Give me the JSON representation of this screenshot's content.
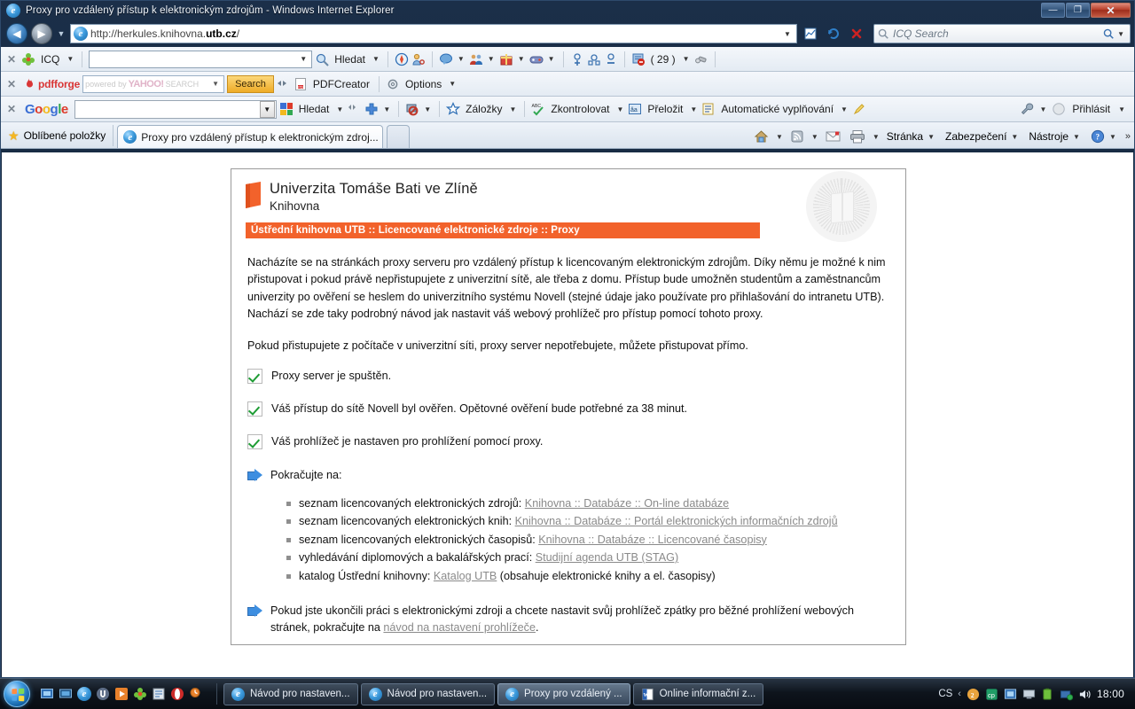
{
  "window": {
    "title": "Proxy pro vzdálený přístup k elektronickým zdrojům - Windows Internet Explorer",
    "minimize_label": "—",
    "maximize_label": "❐",
    "close_label": "✕"
  },
  "address_bar": {
    "url_prefix": "http://herkules.knihovna.",
    "url_bold": "utb.cz",
    "url_suffix": "/",
    "back_label": "◀",
    "forward_label": "▶",
    "history_caret": "▼",
    "page_caret": "▼",
    "refresh_label": "↻",
    "stop_label": "✕",
    "search_placeholder": "ICQ Search",
    "search_caret": "▼"
  },
  "icq_toolbar": {
    "close_label": "✕",
    "brand": "ICQ",
    "brand_caret": "▼",
    "input_value": "",
    "input_caret": "▼",
    "search_label": "Hledat",
    "search_caret": "▼",
    "messages_count": "( 29 )",
    "messages_caret": "▼",
    "caret": "▼",
    "icons": [
      "icq-flower-icon",
      "compass-icon",
      "person-key-icon",
      "chat-bubble-icon",
      "people-icon",
      "gift-icon",
      "game-controller-icon",
      "add-contact-icon",
      "find-contact-icon",
      "remove-contact-icon",
      "blocked-messages-icon",
      "flashlight-icon"
    ]
  },
  "pdfforge_toolbar": {
    "close_label": "✕",
    "brand": "pdfforge",
    "yahoo_powered": "powered by",
    "yahoo_logo": "YAHOO!",
    "yahoo_search_word": "SEARCH",
    "yahoo_caret": "▼",
    "search_button": "Search",
    "pdfcreator_label": "PDFCreator",
    "options_label": "Options",
    "options_caret": "▼"
  },
  "google_toolbar": {
    "close_label": "✕",
    "logo": "Google",
    "input_value": "",
    "input_caret": "▼",
    "search_label": "Hledat",
    "search_caret": "▼",
    "plus_caret": "▼",
    "popup_caret": "▼",
    "bookmarks_label": "Záložky",
    "bookmarks_caret": "▼",
    "spellcheck_label": "Zkontrolovat",
    "spellcheck_caret": "▼",
    "translate_label": "Přeložit",
    "translate_caret": "▼",
    "autofill_label": "Automatické vyplňování",
    "autofill_caret": "▼",
    "wrench_caret": "▼",
    "signin_label": "Přihlásit",
    "signin_caret": "▼"
  },
  "favorites_bar": {
    "favorites_label": "Oblíbené položky",
    "tab_title": "Proxy pro vzdálený přístup k elektronickým zdroj...",
    "new_tab_label": "",
    "commands": [
      {
        "label": "",
        "name": "home-button",
        "caret": "▼"
      },
      {
        "label": "",
        "name": "feeds-button",
        "caret": "▼"
      },
      {
        "label": "",
        "name": "mail-button",
        "caret": ""
      },
      {
        "label": "",
        "name": "print-button",
        "caret": "▼"
      },
      {
        "label": "Stránka",
        "name": "page-menu",
        "caret": "▼"
      },
      {
        "label": "Zabezpečení",
        "name": "security-menu",
        "caret": "▼"
      },
      {
        "label": "Nástroje",
        "name": "tools-menu",
        "caret": "▼"
      },
      {
        "label": "",
        "name": "help-menu",
        "caret": "▼"
      }
    ],
    "overflow_label": "»"
  },
  "page": {
    "brand_university": "Univerzita Tomáše Bati ve Zlíně",
    "brand_unit": "Knihovna",
    "breadcrumb": "Ústřední knihovna UTB :: Licencované elektronické zdroje :: Proxy",
    "intro_paragraph": "Nacházíte se na stránkách proxy serveru pro vzdálený přístup k licencovaným elektronickým zdrojům. Díky němu je možné k nim přistupovat i pokud právě nepřistupujete z univerzitní sítě, ale třeba z domu. Přístup bude umožněn studentům a zaměstnancům univerzity po ověření se heslem do univerzitního systému Novell (stejné údaje jako používate pro přihlašování do intranetu UTB). Nachází se zde taky podrobný návod jak nastavit váš webový prohlížeč pro přístup pomocí tohoto proxy.",
    "direct_paragraph": "Pokud přistupujete z počítače v univerzitní síti, proxy server nepotřebujete, můžete přistupovat přímo.",
    "status_checks": [
      "Proxy server je spuštěn.",
      "Váš přístup do sítě Novell byl ověřen. Opětovné ověření bude potřebné za 38 minut.",
      "Váš prohlížeč je nastaven pro prohlížení pomocí proxy."
    ],
    "continue_heading": "Pokračujte na:",
    "links": [
      {
        "prefix": "seznam licencovaných elektronických zdrojů: ",
        "link": "Knihovna :: Databáze :: On-line databáze",
        "suffix": ""
      },
      {
        "prefix": "seznam licencovaných elektronických knih: ",
        "link": "Knihovna :: Databáze :: Portál elektronických informačních zdrojů",
        "suffix": ""
      },
      {
        "prefix": "seznam licencovaných elektronických časopisů: ",
        "link": "Knihovna :: Databáze :: Licencované časopisy",
        "suffix": ""
      },
      {
        "prefix": "vyhledávání diplomových a bakalářských prací: ",
        "link": "Studijní agenda UTB (STAG)",
        "suffix": ""
      },
      {
        "prefix": "katalog Ústřední knihovny: ",
        "link": "Katalog UTB",
        "suffix": " (obsahuje elektronické knihy a el. časopisy)"
      }
    ],
    "footer_prefix": "Pokud jste ukončili práci s elektronickými zdroji a chcete nastavit svůj prohlížeč zpátky pro běžné prohlížení webových stránek, pokračujte na ",
    "footer_link": "návod na nastavení prohlížeče",
    "footer_suffix": ".",
    "accent_color": "#f2622b",
    "link_color": "#8a8a8a"
  },
  "taskbar": {
    "start_label": "",
    "windows": [
      {
        "label": "Návod pro nastaven...",
        "active": false
      },
      {
        "label": "Návod pro nastaven...",
        "active": false
      },
      {
        "label": "Proxy pro vzdálený ...",
        "active": true
      },
      {
        "label": "Online informační z...",
        "active": false
      }
    ],
    "language": "CS",
    "tray_caret": "‹",
    "clock": "18:00"
  }
}
